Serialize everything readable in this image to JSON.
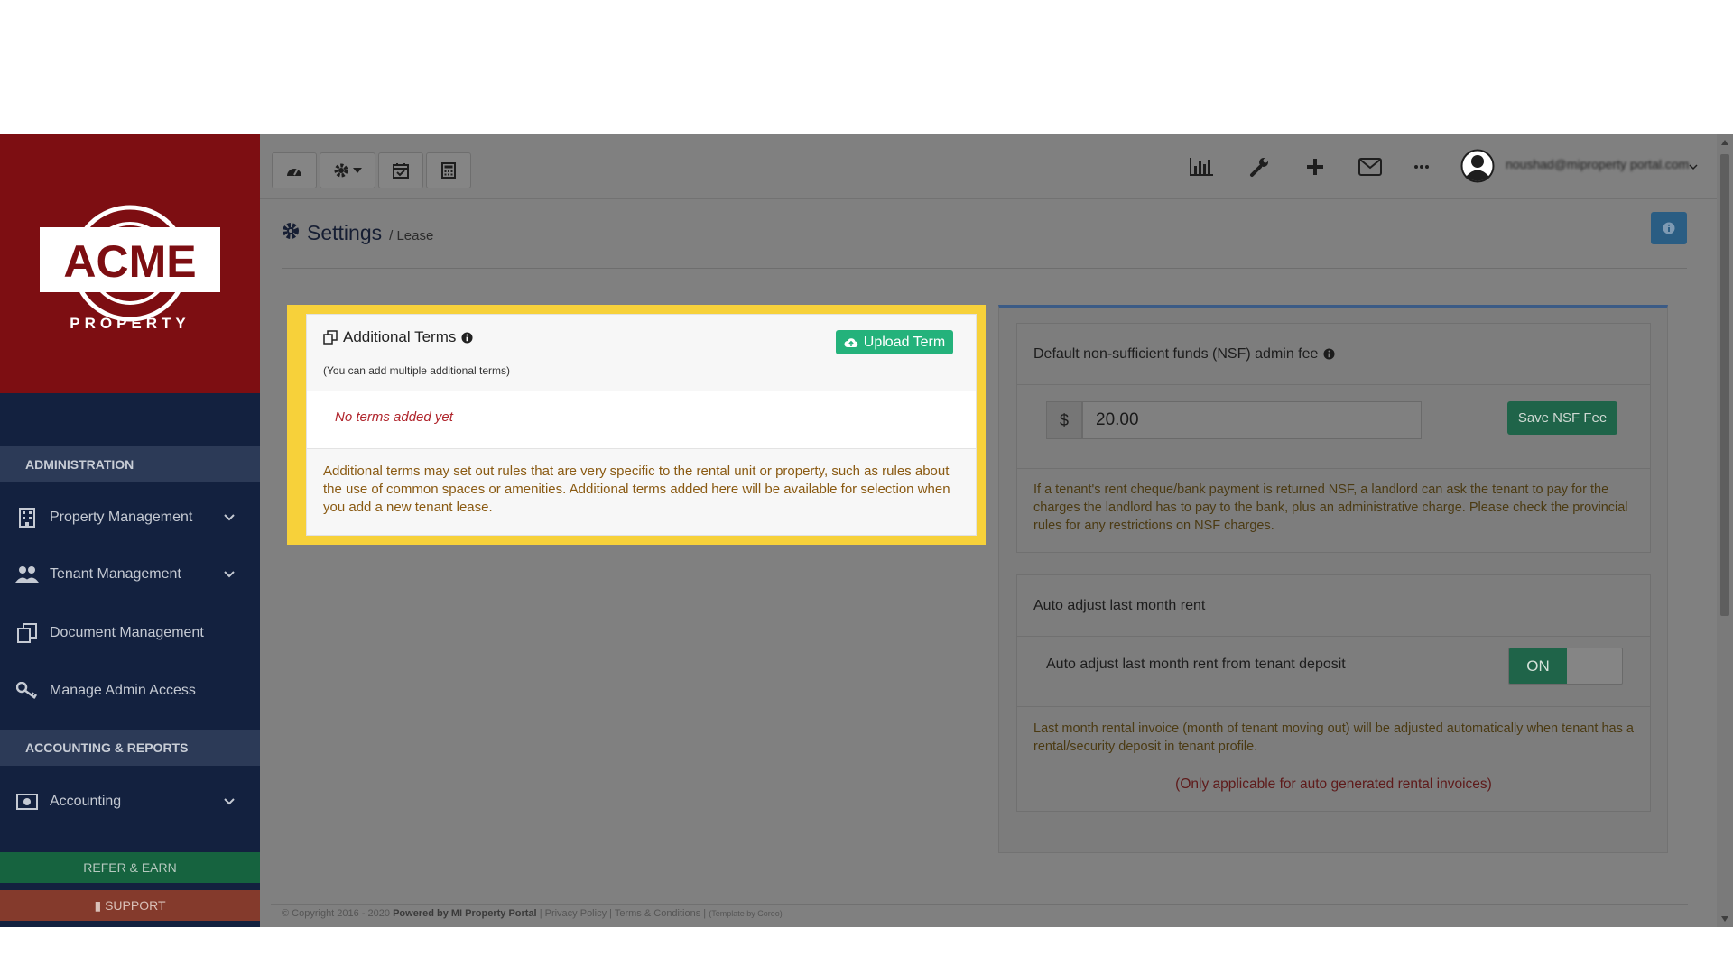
{
  "brand": {
    "logo_main": "ACME",
    "logo_sub": "PROPERTY"
  },
  "sidebar": {
    "section_admin": "ADMINISTRATION",
    "section_accounting": "ACCOUNTING & REPORTS",
    "items": [
      {
        "label": "Property Management",
        "icon": "building-icon"
      },
      {
        "label": "Tenant Management",
        "icon": "users-icon"
      },
      {
        "label": "Document Management",
        "icon": "documents-icon"
      },
      {
        "label": "Manage Admin Access",
        "icon": "key-icon"
      },
      {
        "label": "Accounting",
        "icon": "money-icon"
      }
    ],
    "refer_label": "REFER & EARN",
    "support_label": "SUPPORT"
  },
  "topbar": {
    "user_email": "noushad@miproperty portal.com"
  },
  "page": {
    "title": "Settings",
    "breadcrumb": "/ Lease"
  },
  "additional_terms": {
    "title": "Additional Terms",
    "subtitle": "(You can add multiple additional terms)",
    "upload_label": "Upload Term",
    "empty_message": "No terms added yet",
    "description": "Additional terms may set out rules that are very specific to the rental unit or property, such as rules about the use of common spaces or amenities. Additional terms added here will be available for selection when you add a new tenant lease."
  },
  "nsf": {
    "title": "Default non-sufficient funds (NSF) admin fee",
    "currency": "$",
    "value": "20.00",
    "save_label": "Save NSF Fee",
    "description": "If a tenant's rent cheque/bank payment is returned NSF, a landlord can ask the tenant to pay for the charges the landlord has to pay to the bank, plus an administrative charge. Please check the provincial rules for any restrictions on NSF charges."
  },
  "auto_adjust": {
    "title": "Auto adjust last month rent",
    "label": "Auto adjust last month rent from tenant deposit",
    "toggle_state": "ON",
    "description": "Last month rental invoice (month of tenant moving out) will be adjusted automatically when tenant has a rental/security deposit in tenant profile.",
    "note": "(Only applicable for auto generated rental invoices)"
  },
  "footer": {
    "copyright": "© Copyright 2016 - 2020",
    "powered": "Powered by MI Property Portal",
    "privacy": "Privacy Policy",
    "terms": "Terms & Conditions",
    "template": "(Template by Coreo)"
  },
  "colors": {
    "highlight": "#f7d13a",
    "upload_green": "#24b27b",
    "save_green": "#1f6449",
    "empty_red": "#b0252c"
  }
}
